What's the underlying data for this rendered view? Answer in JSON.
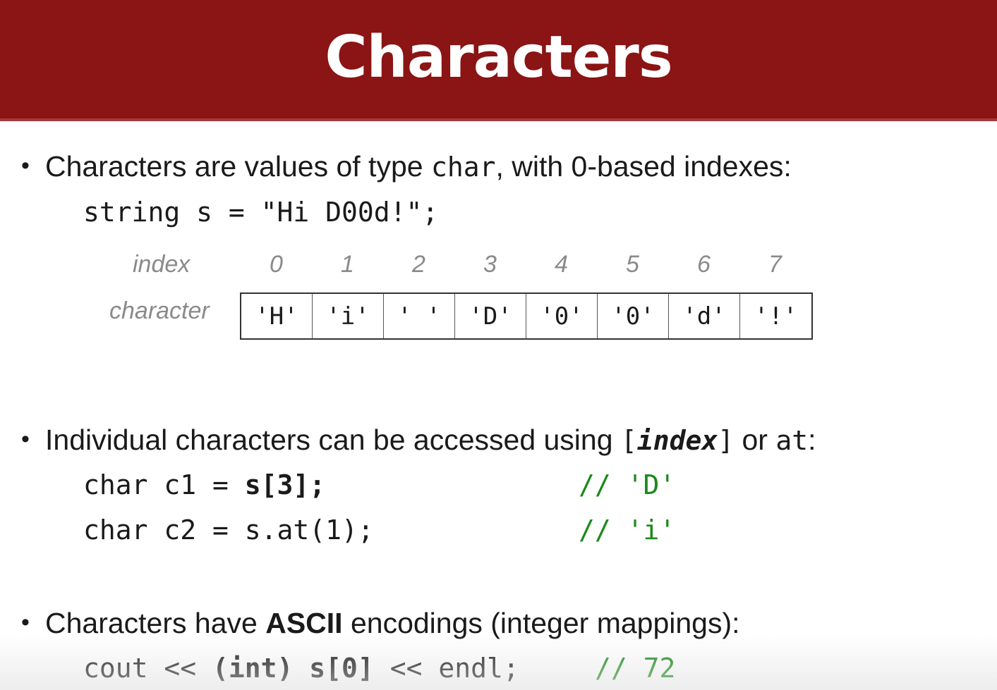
{
  "slide": {
    "title": "Characters",
    "title_bar_color": "#8b1414"
  },
  "bullet1": {
    "text_pre": "Characters are values of type ",
    "text_code": "char",
    "text_post": ", with 0-based indexes:",
    "code_line": "string s = \"Hi D00d!\";"
  },
  "index_table": {
    "index_label": "index",
    "character_label": "character",
    "indexes": [
      "0",
      "1",
      "2",
      "3",
      "4",
      "5",
      "6",
      "7"
    ],
    "characters": [
      "'H'",
      "'i'",
      "' '",
      "'D'",
      "'0'",
      "'0'",
      "'d'",
      "'!'"
    ]
  },
  "bullet2": {
    "text_pre": "Individual characters can be accessed using ",
    "bracket_open": "[",
    "bracket_index": "index",
    "bracket_close": "]",
    "text_or": " or ",
    "text_at": "at",
    "text_colon": ":",
    "line1_pre": "char c1 = ",
    "line1_bold": "s[3];",
    "line1_comment": "// 'D'",
    "line2_code": "char c2 = s.at(1);",
    "line2_comment": "// 'i'"
  },
  "bullet3": {
    "text_pre": "Characters have ",
    "text_bold": "ASCII",
    "text_post": " encodings  (integer mappings):",
    "line_pre": "cout << ",
    "line_bold": "(int) s[0]",
    "line_post": " << endl;",
    "line_comment": "// 72"
  },
  "colors": {
    "comment": "#1a8a1a",
    "label_gray": "#8a8a8a"
  }
}
